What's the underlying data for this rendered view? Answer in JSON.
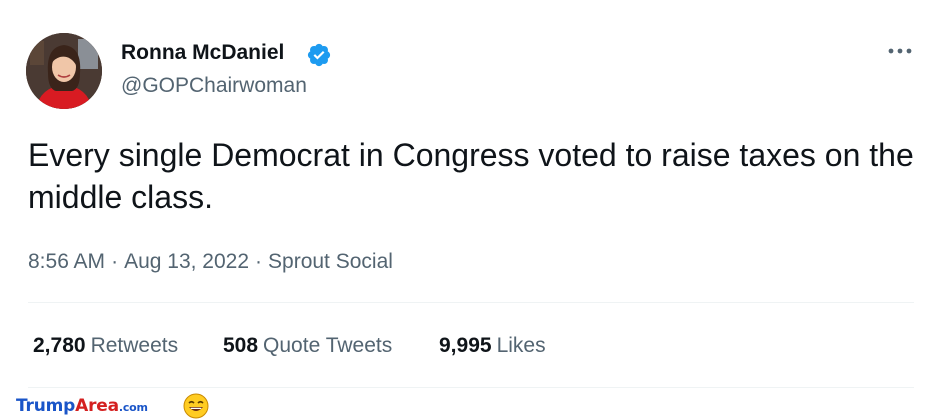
{
  "tweet": {
    "display_name": "Ronna McDaniel",
    "handle": "@GOPChairwoman",
    "text": "Every single Democrat in Congress voted to raise taxes on the middle class.",
    "time": "8:56 AM",
    "date": "Aug 13, 2022",
    "source": "Sprout Social",
    "separator": "·",
    "stats": {
      "retweets": {
        "count": "2,780",
        "label": "Retweets"
      },
      "quotes": {
        "count": "508",
        "label": "Quote Tweets"
      },
      "likes": {
        "count": "9,995",
        "label": "Likes"
      }
    }
  },
  "watermark": {
    "part1": "Trump",
    "part2": "Area",
    "part3": ".com"
  },
  "colors": {
    "verified": "#1d9bf0",
    "text_primary": "#0f1419",
    "text_secondary": "#536471"
  },
  "icons": [
    "verified-badge-icon",
    "more-options-icon",
    "laughing-emoji-icon"
  ]
}
